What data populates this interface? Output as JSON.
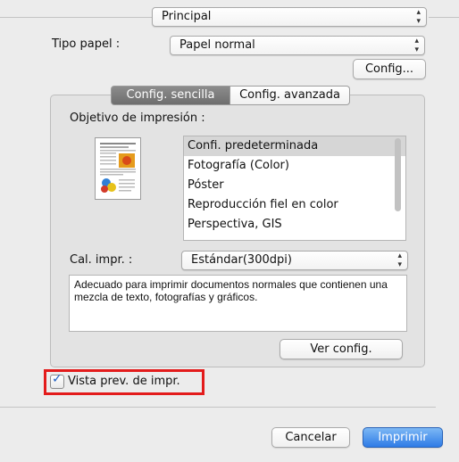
{
  "top_popup": {
    "value": "Principal"
  },
  "paper_type": {
    "label": "Tipo papel :",
    "value": "Papel normal"
  },
  "config_button": {
    "label": "Config..."
  },
  "tabs": [
    {
      "label": "Config. sencilla",
      "active": true
    },
    {
      "label": "Config. avanzada",
      "active": false
    }
  ],
  "objective": {
    "label": "Objetivo de impresión :",
    "items": [
      {
        "label": "Confi. predeterminada",
        "selected": true
      },
      {
        "label": "Fotografía (Color)",
        "selected": false
      },
      {
        "label": "Póster",
        "selected": false
      },
      {
        "label": "Reproducción fiel en color",
        "selected": false
      },
      {
        "label": "Perspectiva, GIS",
        "selected": false
      }
    ]
  },
  "quality": {
    "label": "Cal. impr. :",
    "value": "Estándar(300dpi)"
  },
  "description": {
    "text": "Adecuado para imprimir documentos normales que contienen una mezcla de texto, fotografías y gráficos."
  },
  "view_config_button": {
    "label": "Ver config."
  },
  "preview_checkbox": {
    "label": "Vista prev. de impr.",
    "checked": true
  },
  "footer": {
    "cancel_label": "Cancelar",
    "print_label": "Imprimir"
  },
  "icons": {
    "popup_arrows": "updown-chevron-icon",
    "check": "checkmark-icon",
    "thumbnail": "document-thumbnail-icon"
  },
  "colors": {
    "accent": "#2e7be6",
    "highlight": "#e31b1b"
  }
}
